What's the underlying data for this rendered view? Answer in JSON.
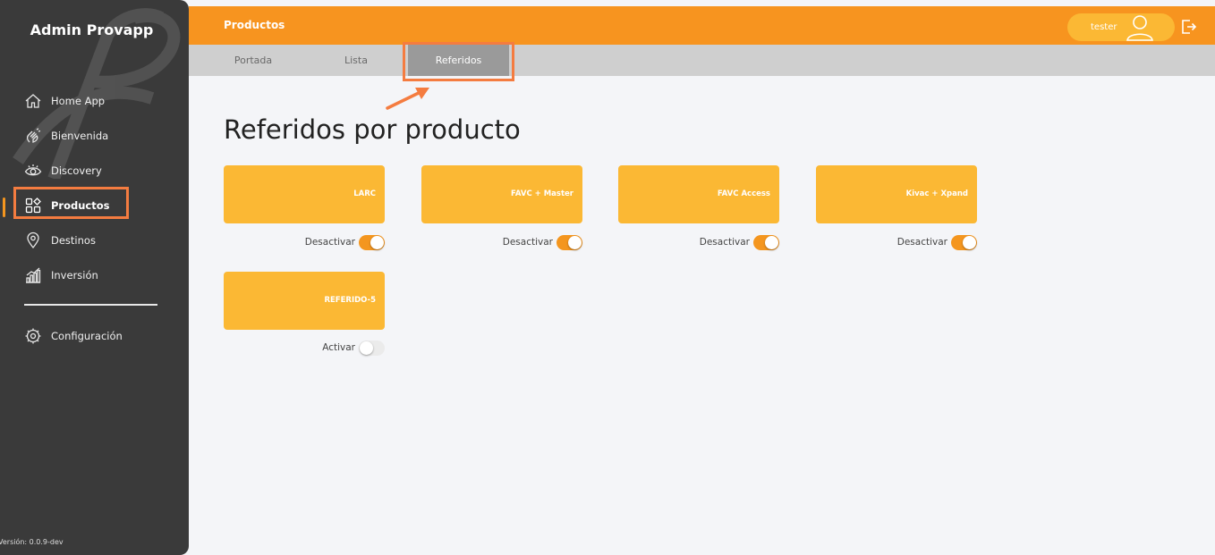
{
  "sidebar": {
    "brand": "Admin Provapp",
    "items": [
      {
        "label": "Home App",
        "icon": "home-icon"
      },
      {
        "label": "Bienvenida",
        "icon": "wave-hand-icon"
      },
      {
        "label": "Discovery",
        "icon": "eye-icon"
      },
      {
        "label": "Productos",
        "icon": "grid-shapes-icon",
        "active": true
      },
      {
        "label": "Destinos",
        "icon": "map-pin-icon"
      },
      {
        "label": "Inversión",
        "icon": "bar-chart-icon"
      }
    ],
    "settings_label": "Configuración",
    "version": "Versión: 0.0.9-dev"
  },
  "header": {
    "title": "Productos",
    "user": "tester"
  },
  "tabs": [
    {
      "label": "Portada"
    },
    {
      "label": "Lista"
    },
    {
      "label": "Referidos",
      "active": true
    }
  ],
  "main": {
    "title": "Referidos por producto",
    "cards": [
      {
        "label": "LARC",
        "toggle_label": "Desactivar",
        "enabled": true
      },
      {
        "label": "FAVC + Master",
        "toggle_label": "Desactivar",
        "enabled": true
      },
      {
        "label": "FAVC Access",
        "toggle_label": "Desactivar",
        "enabled": true
      },
      {
        "label": "Kivac + Xpand",
        "toggle_label": "Desactivar",
        "enabled": true
      },
      {
        "label": "REFERIDO-5",
        "toggle_label": "Activar",
        "enabled": false
      }
    ]
  },
  "colors": {
    "accent": "#f7941f",
    "card": "#fbb834",
    "sidebar": "#3a3a3a",
    "highlight": "#f47c40"
  }
}
